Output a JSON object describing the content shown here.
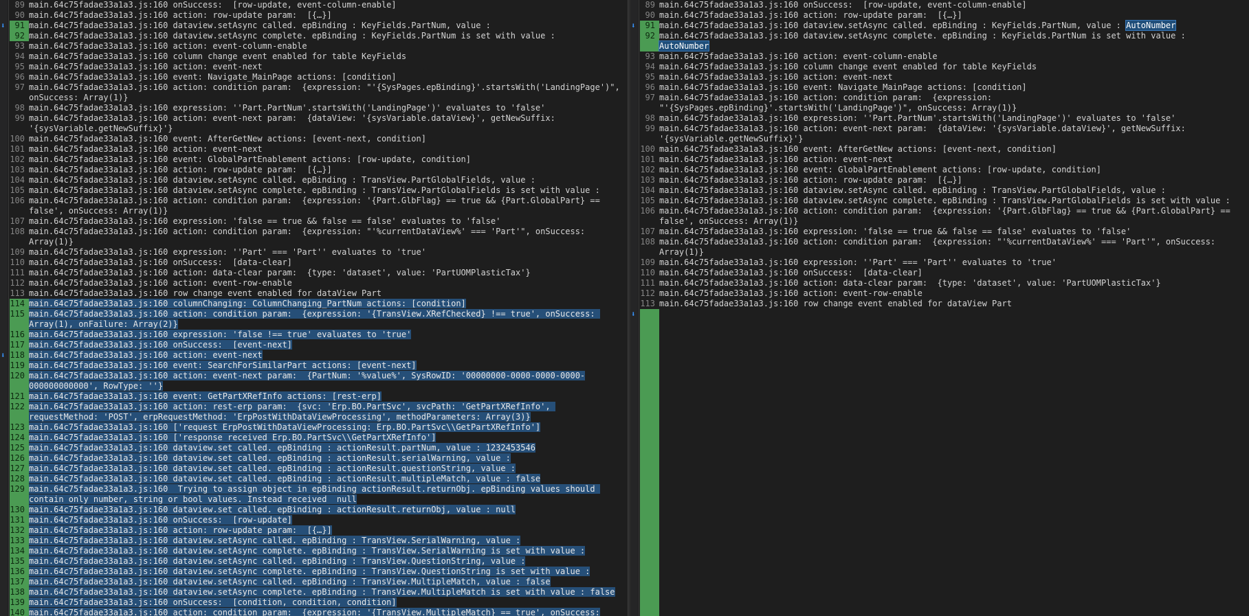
{
  "prefix": "main.64c75fadae33a1a3.js:160 ",
  "arrow_glyph": "⬇",
  "colors": {
    "background": "#1e1e1e",
    "line_number": "#858585",
    "changed_gutter": "#4b9b53",
    "selection": "#264f78",
    "token_highlight": "#1f4e7a"
  },
  "left": {
    "arrows": [
      2,
      29
    ],
    "lines": [
      {
        "num": "89",
        "text": "onSuccess:  [row-update, event-column-enable]"
      },
      {
        "num": "90",
        "text": "action: row-update param:  [{…}]"
      },
      {
        "num": "91",
        "text": "dataview.setAsync called. epBinding : KeyFields.PartNum, value :",
        "mod": true
      },
      {
        "num": "92",
        "text": "dataview.setAsync complete. epBinding : KeyFields.PartNum is set with value :",
        "mod": true
      },
      {
        "num": "93",
        "text": "action: event-column-enable"
      },
      {
        "num": "94",
        "text": "column change event enabled for table KeyFields"
      },
      {
        "num": "95",
        "text": "action: event-next"
      },
      {
        "num": "96",
        "text": "event: Navigate_MainPage actions: [condition]"
      },
      {
        "num": "97",
        "text": "action: condition param:  {expression: \"'{SysPages.epBinding}'.startsWith('LandingPage')\", onSuccess: Array(1)}"
      },
      {
        "num": "98",
        "text": "expression: ''Part.PartNum'.startsWith('LandingPage')' evaluates to 'false'"
      },
      {
        "num": "99",
        "text": "action: event-next param:  {dataView: '{sysVariable.dataView}', getNewSuffix: '{sysVariable.getNewSuffix}'}"
      },
      {
        "num": "100",
        "text": "event: AfterGetNew actions: [event-next, condition]"
      },
      {
        "num": "101",
        "text": "action: event-next"
      },
      {
        "num": "102",
        "text": "event: GlobalPartEnablement actions: [row-update, condition]"
      },
      {
        "num": "103",
        "text": "action: row-update param:  [{…}]"
      },
      {
        "num": "104",
        "text": "dataview.setAsync called. epBinding : TransView.PartGlobalFields, value :"
      },
      {
        "num": "105",
        "text": "dataview.setAsync complete. epBinding : TransView.PartGlobalFields is set with value :"
      },
      {
        "num": "106",
        "text": "action: condition param:  {expression: '{Part.GlbFlag} == true && {Part.GlobalPart} == false', onSuccess: Array(1)}"
      },
      {
        "num": "107",
        "text": "expression: 'false == true && false == false' evaluates to 'false'"
      },
      {
        "num": "108",
        "text": "action: condition param:  {expression: \"'%currentDataView%' === 'Part'\", onSuccess: Array(1)}"
      },
      {
        "num": "109",
        "text": "expression: ''Part' === 'Part'' evaluates to 'true'"
      },
      {
        "num": "110",
        "text": "onSuccess:  [data-clear]"
      },
      {
        "num": "111",
        "text": "action: data-clear param:  {type: 'dataset', value: 'PartUOMPlasticTax'}"
      },
      {
        "num": "112",
        "text": "action: event-row-enable"
      },
      {
        "num": "113",
        "text": "row change event enabled for dataView Part"
      },
      {
        "num": "114",
        "text": "columnChanging: ColumnChanging_PartNum actions: [condition]",
        "mod": true,
        "sel": true
      },
      {
        "num": "115",
        "text": "action: condition param:  {expression: '{TransView.XRefChecked} !== true', onSuccess: Array(1), onFailure: Array(2)}",
        "mod": true,
        "sel": true
      },
      {
        "num": "116",
        "text": "expression: 'false !== true' evaluates to 'true'",
        "mod": true,
        "sel": true
      },
      {
        "num": "117",
        "text": "onSuccess:  [event-next]",
        "mod": true,
        "sel": true
      },
      {
        "num": "118",
        "text": "action: event-next",
        "mod": true,
        "sel": true
      },
      {
        "num": "119",
        "text": "event: SearchForSimilarPart actions: [event-next]",
        "mod": true,
        "sel": true
      },
      {
        "num": "120",
        "text": "action: event-next param:  {PartNum: '%value%', SysRowID: '00000000-0000-0000-0000-000000000000', RowType: ''}",
        "mod": true,
        "sel": true
      },
      {
        "num": "121",
        "text": "event: GetPartXRefInfo actions: [rest-erp]",
        "mod": true,
        "sel": true
      },
      {
        "num": "122",
        "text": "action: rest-erp param:  {svc: 'Erp.BO.PartSvc', svcPath: 'GetPartXRefInfo', requestMethod: 'POST', erpRequestMethod: 'ErpPostWithDataViewProcessing', methodParameters: Array(3)}",
        "mod": true,
        "sel": true
      },
      {
        "num": "123",
        "text": "['request ErpPostWithDataViewProcessing: Erp.BO.PartSvc\\\\GetPartXRefInfo']",
        "mod": true,
        "sel": true
      },
      {
        "num": "124",
        "text": "['response received Erp.BO.PartSvc\\\\GetPartXRefInfo']",
        "mod": true,
        "sel": true
      },
      {
        "num": "125",
        "text": "dataview.set called. epBinding : actionResult.partNum, value : 1232453546",
        "mod": true,
        "sel": true
      },
      {
        "num": "126",
        "text": "dataview.set called. epBinding : actionResult.serialWarning, value :",
        "mod": true,
        "sel": true
      },
      {
        "num": "127",
        "text": "dataview.set called. epBinding : actionResult.questionString, value :",
        "mod": true,
        "sel": true
      },
      {
        "num": "128",
        "text": "dataview.set called. epBinding : actionResult.multipleMatch, value : false",
        "mod": true,
        "sel": true
      },
      {
        "num": "129",
        "text": " Trying to assign object in epBinding actionResult.returnObj. epBinding values should contain only number, string or bool values. Instead received  null",
        "mod": true,
        "sel": true
      },
      {
        "num": "130",
        "text": "dataview.set called. epBinding : actionResult.returnObj, value : null",
        "mod": true,
        "sel": true
      },
      {
        "num": "131",
        "text": "onSuccess:  [row-update]",
        "mod": true,
        "sel": true
      },
      {
        "num": "132",
        "text": "action: row-update param:  [{…}]",
        "mod": true,
        "sel": true
      },
      {
        "num": "133",
        "text": "dataview.setAsync called. epBinding : TransView.SerialWarning, value :",
        "mod": true,
        "sel": true
      },
      {
        "num": "134",
        "text": "dataview.setAsync complete. epBinding : TransView.SerialWarning is set with value :",
        "mod": true,
        "sel": true
      },
      {
        "num": "135",
        "text": "dataview.setAsync called. epBinding : TransView.QuestionString, value :",
        "mod": true,
        "sel": true
      },
      {
        "num": "136",
        "text": "dataview.setAsync complete. epBinding : TransView.QuestionString is set with value :",
        "mod": true,
        "sel": true
      },
      {
        "num": "137",
        "text": "dataview.setAsync called. epBinding : TransView.MultipleMatch, value : false",
        "mod": true,
        "sel": true
      },
      {
        "num": "138",
        "text": "dataview.setAsync complete. epBinding : TransView.MultipleMatch is set with value : false",
        "mod": true,
        "sel": true
      },
      {
        "num": "139",
        "text": "onSuccess:  [condition, condition, condition]",
        "mod": true,
        "sel": true
      },
      {
        "num": "140",
        "text": "action: condition param:  {expression: '{TransView.MultipleMatch} == true', onSuccess:",
        "mod": true,
        "sel": true
      }
    ]
  },
  "right": {
    "arrows": [
      2,
      29
    ],
    "lines": [
      {
        "num": "89",
        "text": "onSuccess:  [row-update, event-column-enable]"
      },
      {
        "num": "90",
        "text": "action: row-update param:  [{…}]"
      },
      {
        "num": "91",
        "text": "dataview.setAsync called. epBinding : KeyFields.PartNum, value : ",
        "tok": "AutoNumber",
        "mod": true
      },
      {
        "num": "92",
        "text": "dataview.setAsync complete. epBinding : KeyFields.PartNum is set with value : ",
        "tok": "AutoNumber",
        "mod": true
      },
      {
        "num": "93",
        "text": "action: event-column-enable"
      },
      {
        "num": "94",
        "text": "column change event enabled for table KeyFields"
      },
      {
        "num": "95",
        "text": "action: event-next"
      },
      {
        "num": "96",
        "text": "event: Navigate_MainPage actions: [condition]"
      },
      {
        "num": "97",
        "text": "action: condition param:  {expression: \"'{SysPages.epBinding}'.startsWith('LandingPage')\", onSuccess: Array(1)}"
      },
      {
        "num": "98",
        "text": "expression: ''Part.PartNum'.startsWith('LandingPage')' evaluates to 'false'"
      },
      {
        "num": "99",
        "text": "action: event-next param:  {dataView: '{sysVariable.dataView}', getNewSuffix: '{sysVariable.getNewSuffix}'}"
      },
      {
        "num": "100",
        "text": "event: AfterGetNew actions: [event-next, condition]"
      },
      {
        "num": "101",
        "text": "action: event-next"
      },
      {
        "num": "102",
        "text": "event: GlobalPartEnablement actions: [row-update, condition]"
      },
      {
        "num": "103",
        "text": "action: row-update param:  [{…}]"
      },
      {
        "num": "104",
        "text": "dataview.setAsync called. epBinding : TransView.PartGlobalFields, value :"
      },
      {
        "num": "105",
        "text": "dataview.setAsync complete. epBinding : TransView.PartGlobalFields is set with value :"
      },
      {
        "num": "106",
        "text": "action: condition param:  {expression: '{Part.GlbFlag} == true && {Part.GlobalPart} == false', onSuccess: Array(1)}"
      },
      {
        "num": "107",
        "text": "expression: 'false == true && false == false' evaluates to 'false'"
      },
      {
        "num": "108",
        "text": "action: condition param:  {expression: \"'%currentDataView%' === 'Part'\", onSuccess: Array(1)}"
      },
      {
        "num": "109",
        "text": "expression: ''Part' === 'Part'' evaluates to 'true'"
      },
      {
        "num": "110",
        "text": "onSuccess:  [data-clear]"
      },
      {
        "num": "111",
        "text": "action: data-clear param:  {type: 'dataset', value: 'PartUOMPlasticTax'}"
      },
      {
        "num": "112",
        "text": "action: event-row-enable"
      },
      {
        "num": "113",
        "text": "row change event enabled for dataView Part"
      }
    ]
  }
}
